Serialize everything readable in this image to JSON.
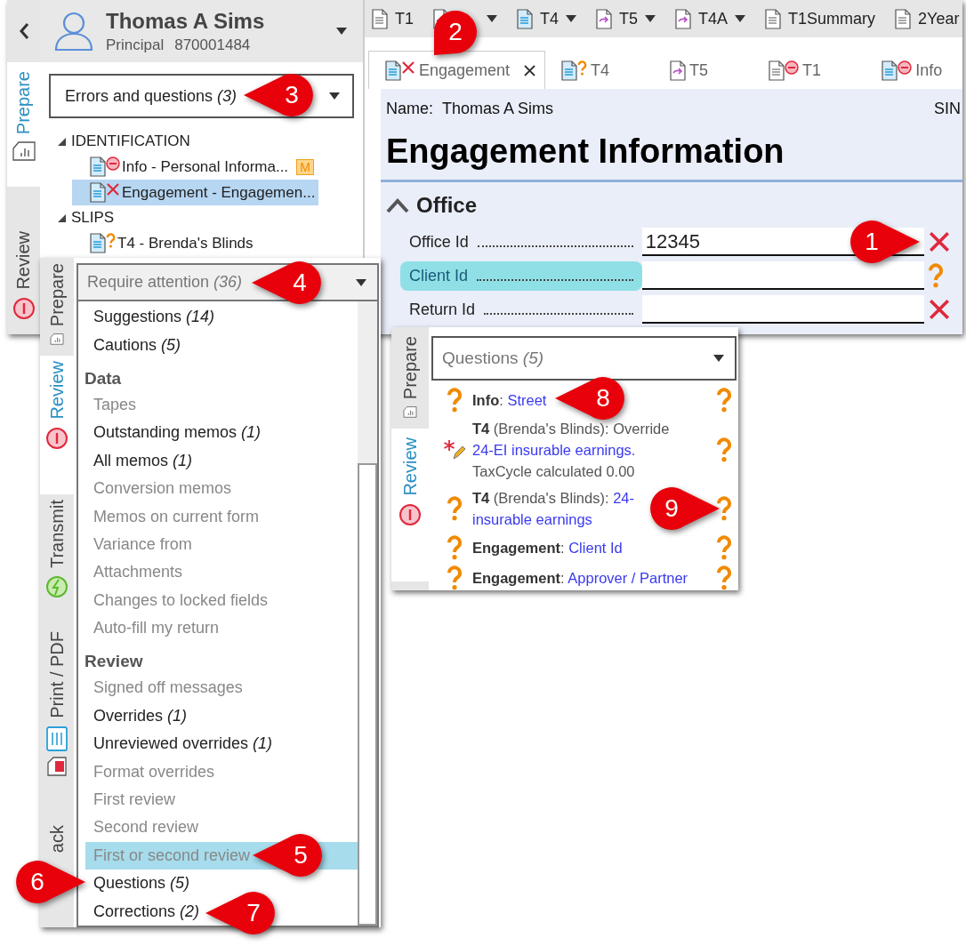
{
  "main_window": {
    "side_tabs": [
      {
        "label": "Prepare",
        "kind": "prepare",
        "selected": true
      },
      {
        "label": "Review",
        "kind": "review",
        "selected": false
      }
    ],
    "client": {
      "name": "Thomas A Sims",
      "role": "Principal",
      "id": "870001484"
    },
    "filter": {
      "label": "Errors and questions",
      "count": "(3)"
    },
    "tree": [
      {
        "label": "IDENTIFICATION",
        "expanded": true,
        "children": [
          {
            "label": "Info - Personal Informa...",
            "error": false,
            "stopped": true,
            "question": false,
            "badge": "M",
            "selected": false
          },
          {
            "label": "Engagement - Engagemen...",
            "error": true,
            "stopped": false,
            "question": false,
            "selected": true
          }
        ]
      },
      {
        "label": "SLIPS",
        "expanded": true,
        "children": [
          {
            "label": "T4 - Brenda's Blinds",
            "error": false,
            "stopped": false,
            "question": true,
            "selected": false
          }
        ]
      }
    ],
    "toolbar": [
      {
        "label": "T1",
        "kind": "plain",
        "dropdown": false
      },
      {
        "kind": "slip",
        "dropdown": true
      },
      {
        "label": "T4",
        "kind": "form",
        "dropdown": true
      },
      {
        "label": "T5",
        "kind": "slip",
        "dropdown": true
      },
      {
        "label": "T4A",
        "kind": "slip",
        "dropdown": true
      },
      {
        "label": "T1Summary",
        "kind": "plain",
        "dropdown": false
      },
      {
        "label": "2Year",
        "kind": "plain",
        "dropdown": false
      }
    ],
    "tabs": [
      {
        "label": "Engagement",
        "kind": "form",
        "error": true,
        "stopped": false,
        "question": false,
        "selected": true,
        "closable": true
      },
      {
        "label": "T4",
        "kind": "form",
        "error": false,
        "stopped": false,
        "question": true,
        "selected": false,
        "closable": false
      },
      {
        "label": "T5",
        "kind": "slip",
        "error": false,
        "stopped": false,
        "question": false,
        "selected": false,
        "closable": false
      },
      {
        "label": "T1",
        "kind": "plain",
        "error": false,
        "stopped": true,
        "question": false,
        "selected": false,
        "closable": false
      },
      {
        "label": "Info",
        "kind": "form",
        "error": false,
        "stopped": true,
        "question": false,
        "selected": false,
        "closable": false
      }
    ],
    "form": {
      "name_label": "Name:",
      "name_value": "Thomas A Sims",
      "sin_label": "SIN",
      "title": "Engagement Information",
      "section": {
        "title": "Office",
        "expanded": true
      },
      "fields": [
        {
          "label": "Office Id",
          "value": "12345",
          "error": true,
          "question": false,
          "highlighted": false
        },
        {
          "label": "Client Id",
          "error": false,
          "question": true,
          "highlighted": true
        },
        {
          "label": "Return Id",
          "error": true,
          "question": false,
          "highlighted": false
        }
      ]
    }
  },
  "filter_window": {
    "side_tabs": [
      {
        "label": "Prepare",
        "kind": "prepare",
        "selected": false
      },
      {
        "label": "Review",
        "kind": "review",
        "selected": true
      },
      {
        "label": "Transmit",
        "kind": "transmit",
        "selected": false
      },
      {
        "label": "Print / PDF",
        "kind": "print",
        "selected": false
      },
      {
        "label": "ack",
        "kind": "plain",
        "selected": false
      }
    ],
    "dropdown": {
      "label": "Require attention",
      "count": "(36)"
    },
    "options": [
      {
        "kind": "option",
        "label": "Suggestions",
        "count": "(14)",
        "disabled": false,
        "selected": false
      },
      {
        "kind": "option",
        "label": "Cautions",
        "count": "(5)",
        "disabled": false,
        "selected": false
      },
      {
        "kind": "heading",
        "label": "Data"
      },
      {
        "kind": "option",
        "label": "Tapes",
        "disabled": true,
        "selected": false
      },
      {
        "kind": "option",
        "label": "Outstanding memos",
        "count": "(1)",
        "disabled": false,
        "selected": false
      },
      {
        "kind": "option",
        "label": "All memos",
        "count": "(1)",
        "disabled": false,
        "selected": false
      },
      {
        "kind": "option",
        "label": "Conversion memos",
        "disabled": true,
        "selected": false
      },
      {
        "kind": "option",
        "label": "Memos on current form",
        "disabled": true,
        "selected": false
      },
      {
        "kind": "option",
        "label": "Variance from",
        "disabled": true,
        "selected": false
      },
      {
        "kind": "option",
        "label": "Attachments",
        "disabled": true,
        "selected": false
      },
      {
        "kind": "option",
        "label": "Changes to locked fields",
        "disabled": true,
        "selected": false
      },
      {
        "kind": "option",
        "label": "Auto-fill my return",
        "disabled": true,
        "selected": false
      },
      {
        "kind": "heading",
        "label": "Review"
      },
      {
        "kind": "option",
        "label": "Signed off messages",
        "disabled": true,
        "selected": false
      },
      {
        "kind": "option",
        "label": "Overrides",
        "count": "(1)",
        "disabled": false,
        "selected": false
      },
      {
        "kind": "option",
        "label": "Unreviewed overrides",
        "count": "(1)",
        "disabled": false,
        "selected": false
      },
      {
        "kind": "option",
        "label": "Format overrides",
        "disabled": true,
        "selected": false
      },
      {
        "kind": "option",
        "label": "First review",
        "disabled": true,
        "selected": false
      },
      {
        "kind": "option",
        "label": "Second review",
        "disabled": true,
        "selected": false
      },
      {
        "kind": "option",
        "label": "First or second review",
        "disabled": true,
        "selected": true
      },
      {
        "kind": "option",
        "label": "Questions",
        "count": "(5)",
        "disabled": false,
        "selected": false
      },
      {
        "kind": "option",
        "label": "Corrections",
        "count": "(2)",
        "disabled": false,
        "selected": false
      }
    ]
  },
  "questions_window": {
    "side_tabs": [
      {
        "label": "Prepare",
        "kind": "prepare",
        "selected": false
      },
      {
        "label": "Review",
        "kind": "review",
        "selected": true
      }
    ],
    "dropdown": {
      "label": "Questions",
      "count": "(5)"
    },
    "items": [
      {
        "kind": "question",
        "form": "Info",
        "text": ":",
        "links": [
          "Street"
        ]
      },
      {
        "kind": "override",
        "form": "T4",
        "text": "(Brenda's Blinds): Override",
        "links": [
          "24-EI insurable earnings."
        ],
        "note": "TaxCycle calculated 0.00"
      },
      {
        "kind": "question",
        "form": "T4",
        "text": "(Brenda's Blinds):",
        "links": [
          "24-",
          "insurable earnings"
        ]
      },
      {
        "kind": "question",
        "form": "Engagement",
        "text": ":",
        "links": [
          "Client Id"
        ]
      },
      {
        "kind": "question",
        "form": "Engagement",
        "text": ":",
        "links": [
          "Approver / Partner"
        ]
      }
    ]
  },
  "callouts": [
    {
      "number": "1"
    },
    {
      "number": "2"
    },
    {
      "number": "3"
    },
    {
      "number": "4"
    },
    {
      "number": "5"
    },
    {
      "number": "6"
    },
    {
      "number": "7"
    },
    {
      "number": "8"
    },
    {
      "number": "9"
    }
  ]
}
